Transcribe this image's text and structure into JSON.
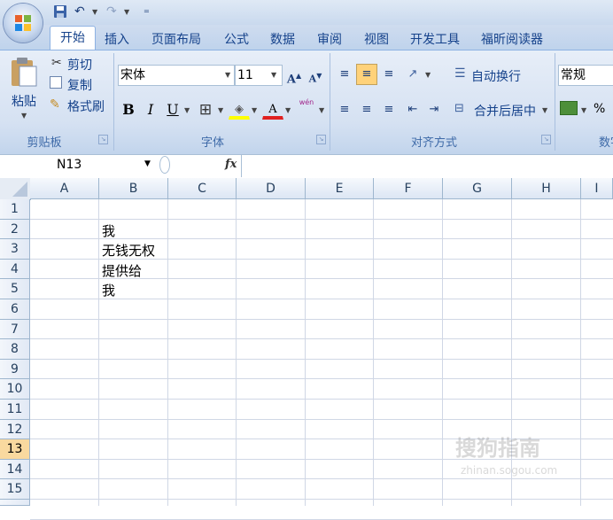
{
  "qat": {
    "undo": "↶",
    "redo": "↷",
    "more": "▼"
  },
  "tabs": [
    "开始",
    "插入",
    "页面布局",
    "公式",
    "数据",
    "审阅",
    "视图",
    "开发工具",
    "福昕阅读器"
  ],
  "clipboard": {
    "paste": "粘贴",
    "cut": "剪切",
    "copy": "复制",
    "format_painter": "格式刷",
    "label": "剪贴板"
  },
  "font": {
    "name": "宋体",
    "size": "11",
    "bold": "B",
    "italic": "I",
    "underline": "U",
    "phonetic": "wén",
    "label": "字体"
  },
  "alignment": {
    "wrap_text": "自动换行",
    "merge_center": "合并后居中",
    "label": "对齐方式"
  },
  "number": {
    "format": "常规",
    "percent": "%",
    "label": "数字"
  },
  "formula_bar": {
    "name_box": "N13",
    "fx": "fx",
    "value": ""
  },
  "sheet": {
    "columns": [
      "A",
      "B",
      "C",
      "D",
      "E",
      "F",
      "G",
      "H",
      "I"
    ],
    "rows": [
      "1",
      "2",
      "3",
      "4",
      "5",
      "6",
      "7",
      "8",
      "9",
      "10",
      "11",
      "12",
      "13",
      "14",
      "15"
    ],
    "active_row": "13",
    "cells": {
      "B2": "我",
      "B3": "无钱无权",
      "B4": "提供给",
      "B5": "我"
    }
  },
  "watermark": {
    "text": "搜狗指南",
    "sub": "zhinan.sogou.com"
  }
}
